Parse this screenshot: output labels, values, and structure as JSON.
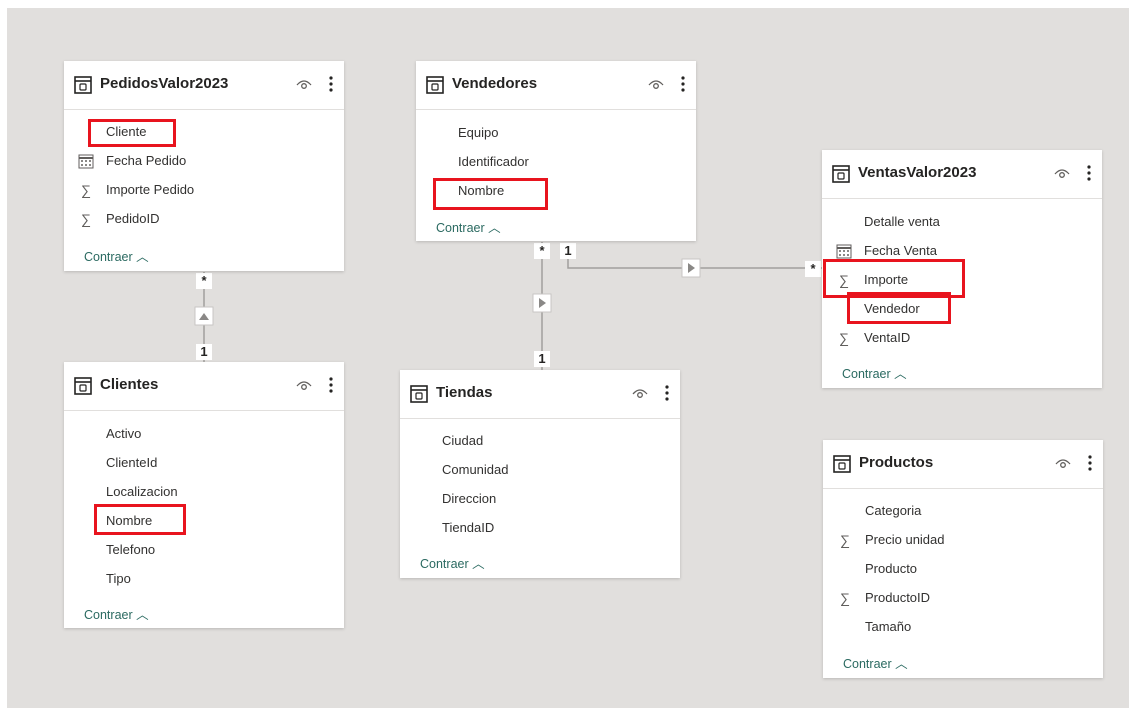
{
  "tables": [
    {
      "name": "PedidosValor2023",
      "fields": [
        {
          "label": "Cliente",
          "icon": "none"
        },
        {
          "label": "Fecha Pedido",
          "icon": "calendar-icon"
        },
        {
          "label": "Importe Pedido",
          "icon": "sigma-icon"
        },
        {
          "label": "PedidoID",
          "icon": "sigma-icon"
        }
      ],
      "collapse": "Contraer"
    },
    {
      "name": "Vendedores",
      "fields": [
        {
          "label": "Equipo",
          "icon": "none"
        },
        {
          "label": "Identificador",
          "icon": "none"
        },
        {
          "label": "Nombre",
          "icon": "none"
        }
      ],
      "collapse": "Contraer"
    },
    {
      "name": "VentasValor2023",
      "fields": [
        {
          "label": "Detalle venta",
          "icon": "none"
        },
        {
          "label": "Fecha Venta",
          "icon": "calendar-icon"
        },
        {
          "label": "Importe",
          "icon": "sigma-icon"
        },
        {
          "label": "Vendedor",
          "icon": "none"
        },
        {
          "label": "VentaID",
          "icon": "sigma-icon"
        }
      ],
      "collapse": "Contraer"
    },
    {
      "name": "Clientes",
      "fields": [
        {
          "label": "Activo",
          "icon": "none"
        },
        {
          "label": "ClienteId",
          "icon": "none"
        },
        {
          "label": "Localizacion",
          "icon": "none"
        },
        {
          "label": "Nombre",
          "icon": "none"
        },
        {
          "label": "Telefono",
          "icon": "none"
        },
        {
          "label": "Tipo",
          "icon": "none"
        }
      ],
      "collapse": "Contraer"
    },
    {
      "name": "Tiendas",
      "fields": [
        {
          "label": "Ciudad",
          "icon": "none"
        },
        {
          "label": "Comunidad",
          "icon": "none"
        },
        {
          "label": "Direccion",
          "icon": "none"
        },
        {
          "label": "TiendaID",
          "icon": "none"
        }
      ],
      "collapse": "Contraer"
    },
    {
      "name": "Productos",
      "fields": [
        {
          "label": "Categoria",
          "icon": "none"
        },
        {
          "label": "Precio unidad",
          "icon": "sigma-icon"
        },
        {
          "label": "Producto",
          "icon": "none"
        },
        {
          "label": "ProductoID",
          "icon": "sigma-icon"
        },
        {
          "label": "Tamaño",
          "icon": "none"
        }
      ],
      "collapse": "Contraer"
    }
  ],
  "relationships": [
    {
      "from": "Clientes",
      "to": "PedidosValor2023",
      "from_card": "1",
      "to_card": "*"
    },
    {
      "from": "Tiendas",
      "to": "Vendedores",
      "from_card": "1",
      "to_card": "*"
    },
    {
      "from": "Vendedores",
      "to": "VentasValor2023",
      "from_card": "1",
      "to_card": "*"
    }
  ],
  "cardinality": {
    "one": "1",
    "many": "*"
  },
  "colors": {
    "highlight": "#e8141e",
    "canvas": "#e1dfdd",
    "link": "#2b6a61"
  }
}
